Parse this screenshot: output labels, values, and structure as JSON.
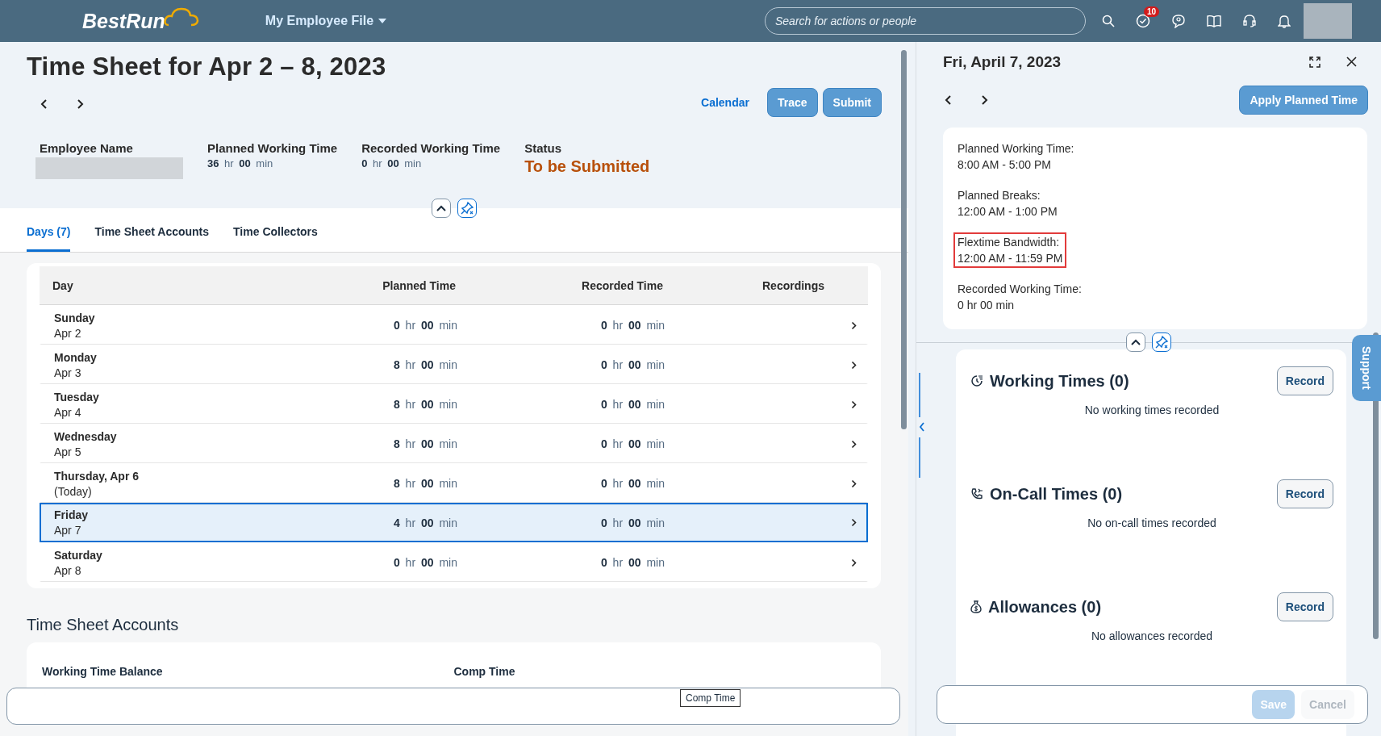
{
  "header": {
    "logo": "BestRun",
    "menu": "My Employee File",
    "search": {
      "placeholder": "Search for actions or people"
    },
    "notification_count": "10"
  },
  "timesheet": {
    "title": "Time Sheet for Apr 2 – 8, 2023",
    "actions": [
      {
        "label": "Calendar",
        "kind": "link"
      },
      {
        "label": "Trace",
        "kind": "button"
      },
      {
        "label": "Submit",
        "kind": "button"
      }
    ],
    "attributes": [
      {
        "label": "Employee Name",
        "kind": "redacted"
      },
      {
        "label": "Planned Working Time",
        "kind": "duration",
        "value": "**36** hr **00** min"
      },
      {
        "label": "Recorded Working Time",
        "kind": "duration",
        "value": "**0** hr **00** min"
      },
      {
        "label": "Status",
        "kind": "status",
        "value": "To be Submitted"
      }
    ],
    "tabs": [
      {
        "label": "Days (7)",
        "selected": true
      },
      {
        "label": "Time Sheet Accounts",
        "selected": false
      },
      {
        "label": "Time Collectors",
        "selected": false
      }
    ],
    "table": {
      "columns": [
        "Day",
        "Planned Time",
        "Recorded Time",
        "Recordings"
      ],
      "rows": [
        {
          "day": "Sunday",
          "date": "Apr 2",
          "planned": "**0** hr **00** min",
          "recorded": "**0** hr **00** min",
          "selected": false
        },
        {
          "day": "Monday",
          "date": "Apr 3",
          "planned": "**8** hr **00** min",
          "recorded": "**0** hr **00** min",
          "selected": false
        },
        {
          "day": "Tuesday",
          "date": "Apr 4",
          "planned": "**8** hr **00** min",
          "recorded": "**0** hr **00** min",
          "selected": false
        },
        {
          "day": "Wednesday",
          "date": "Apr 5",
          "planned": "**8** hr **00** min",
          "recorded": "**0** hr **00** min",
          "selected": false
        },
        {
          "day": "Thursday, Apr 6",
          "date": "(Today)",
          "planned": "**8** hr **00** min",
          "recorded": "**0** hr **00** min",
          "selected": false
        },
        {
          "day": "Friday",
          "date": "Apr 7",
          "planned": "**4** hr **00** min",
          "recorded": "**0** hr **00** min",
          "selected": true
        },
        {
          "day": "Saturday",
          "date": "Apr 8",
          "planned": "**0** hr **00** min",
          "recorded": "**0** hr **00** min",
          "selected": false
        }
      ]
    },
    "accounts": {
      "title": "Time Sheet Accounts",
      "columns": [
        "Working Time Balance",
        "Comp Time"
      ]
    },
    "tooltip": "Comp Time"
  },
  "detail": {
    "title": "Fri, April 7, 2023",
    "apply_button": "Apply Planned Time",
    "info": [
      {
        "label": "Planned Working Time:",
        "value": "8:00 AM - 5:00 PM",
        "highlighted": false
      },
      {
        "label": "Planned Breaks:",
        "value": "12:00 AM - 1:00 PM",
        "highlighted": false
      },
      {
        "label": "Flextime Bandwidth:",
        "value": "12:00 AM - 11:59 PM",
        "highlighted": true
      },
      {
        "label": "Recorded Working Time:",
        "value": "0 hr 00 min",
        "highlighted": false
      }
    ],
    "sections": [
      {
        "kind": "working",
        "title": "Working Times (0)",
        "action": "Record",
        "empty": "No working times recorded"
      },
      {
        "kind": "oncall",
        "title": "On-Call Times (0)",
        "action": "Record",
        "empty": "No on-call times recorded"
      },
      {
        "kind": "allowance",
        "title": "Allowances (0)",
        "action": "Record",
        "empty": "No allowances recorded"
      }
    ],
    "footer": [
      {
        "label": "Save",
        "kind": "primary",
        "disabled": true
      },
      {
        "label": "Cancel",
        "kind": "secondary",
        "disabled": true
      }
    ]
  },
  "support_tab": "Support"
}
